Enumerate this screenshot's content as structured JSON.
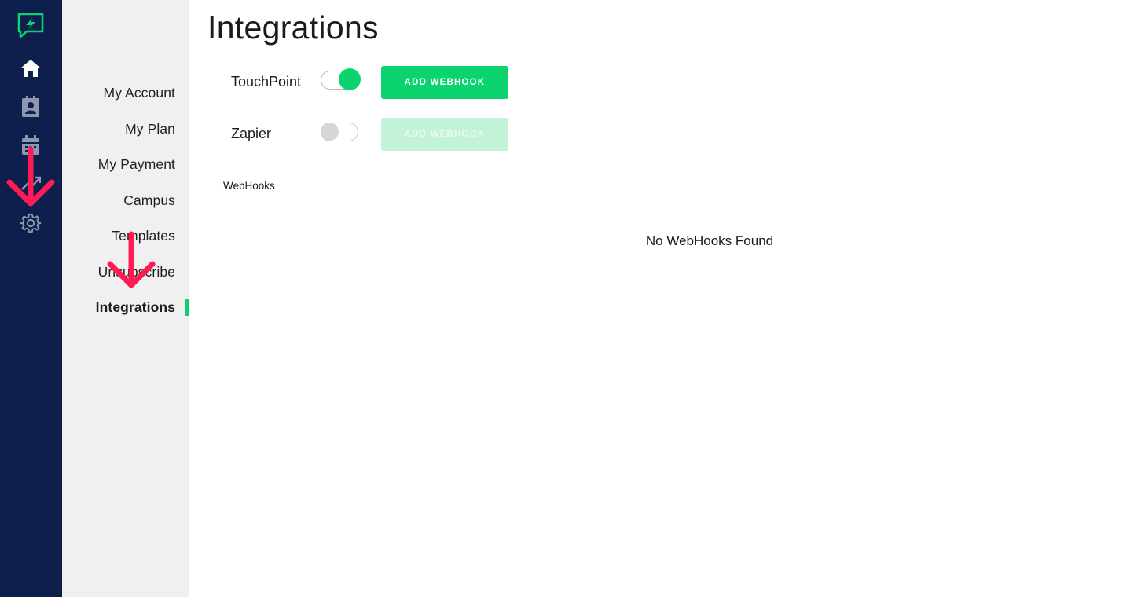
{
  "rail": {
    "icons": [
      "chat-bolt-logo-icon",
      "home-icon",
      "contacts-icon",
      "calendar-icon",
      "analytics-icon",
      "gear-icon"
    ],
    "accent_color": "#0bd46f",
    "background_color": "#0e1e4d"
  },
  "submenu": {
    "items": [
      {
        "label": "My Account",
        "active": false
      },
      {
        "label": "My Plan",
        "active": false
      },
      {
        "label": "My Payment",
        "active": false
      },
      {
        "label": "Campus",
        "active": false
      },
      {
        "label": "Templates",
        "active": false
      },
      {
        "label": "Unsubscribe",
        "active": false
      },
      {
        "label": "Integrations",
        "active": true
      }
    ]
  },
  "main": {
    "title": "Integrations",
    "integrations": [
      {
        "name": "TouchPoint",
        "enabled": true,
        "button_label": "ADD WEBHOOK",
        "button_enabled": true
      },
      {
        "name": "Zapier",
        "enabled": false,
        "button_label": "ADD WEBHOOK",
        "button_enabled": false
      }
    ],
    "webhooks_label": "WebHooks",
    "empty_message": "No WebHooks Found"
  },
  "annotations": {
    "arrow_color": "#ff1c55",
    "arrows": [
      "down-arrow-to-settings-icon",
      "down-arrow-to-integrations-item"
    ]
  }
}
